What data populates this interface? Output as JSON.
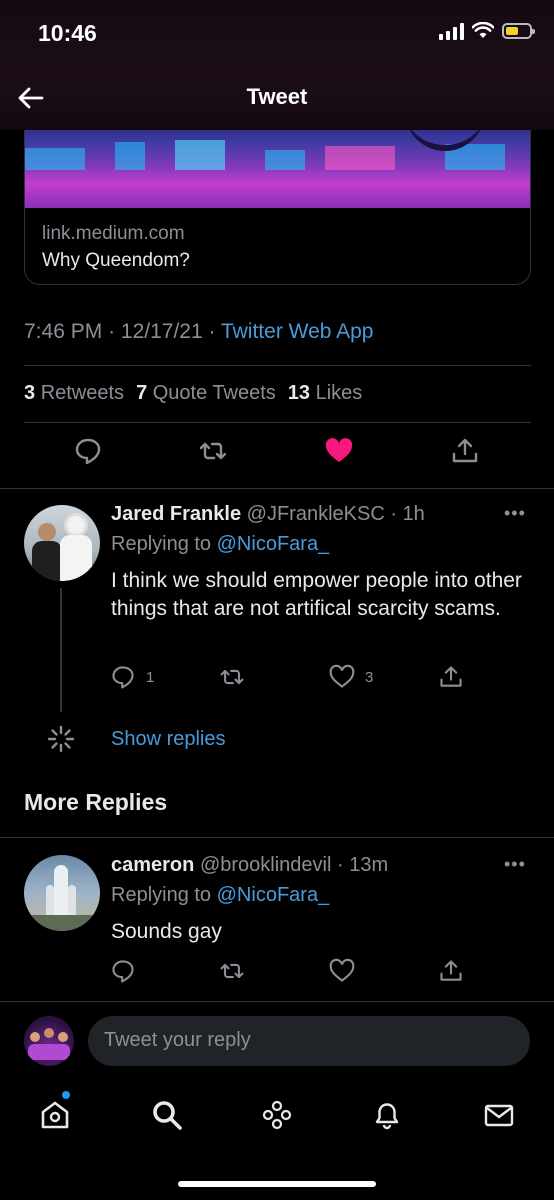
{
  "status_bar": {
    "time": "10:46"
  },
  "header": {
    "title": "Tweet"
  },
  "link_card": {
    "domain": "link.medium.com",
    "title": "Why Queendom?"
  },
  "tweet_meta": {
    "time": "7:46 PM",
    "date": "12/17/21",
    "separator": "·",
    "source": "Twitter Web App"
  },
  "stats": {
    "retweets_count": "3",
    "retweets_label": "Retweets",
    "quotes_count": "7",
    "quotes_label": "Quote Tweets",
    "likes_count": "13",
    "likes_label": "Likes"
  },
  "reply1": {
    "name": "Jared Frankle",
    "handle": "@JFrankleKSC",
    "time": "· 1h",
    "replying_prefix": "Replying to",
    "replying_handle": "@NicoFara_",
    "text": "I think we should empower people into other things that are not artifical scarcity scams.",
    "reply_count": "1",
    "like_count": "3"
  },
  "show_replies": "Show replies",
  "more_replies_heading": "More Replies",
  "reply2": {
    "name": "cameron",
    "handle": "@brooklindevil",
    "time": "· 13m",
    "replying_prefix": "Replying to",
    "replying_handle": "@NicoFara_",
    "text": "Sounds gay"
  },
  "composer": {
    "placeholder": "Tweet your reply"
  },
  "tabs": [
    "home-icon",
    "search-icon",
    "spaces-icon",
    "notifications-icon",
    "messages-icon"
  ],
  "colors": {
    "accent": "#4a9bd9",
    "like": "#f91880",
    "background": "#000000"
  }
}
